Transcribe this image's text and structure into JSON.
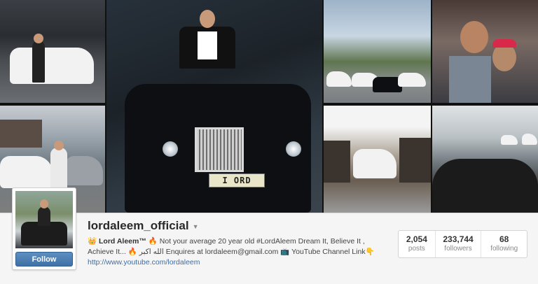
{
  "profile": {
    "username": "lordaleem_official",
    "bio_name": "👑 Lord Aleem™",
    "bio_line1": " 🔥 Not your average 20 year old #LordAleem Dream It, Believe It ,",
    "bio_line2": "Achieve It... 🔥 الله اكبر Enquires at lordaleem@gmail.com 📺 YouTube Channel Link👇",
    "website": "http://www.youtube.com/lordaleem",
    "follow_label": "Follow",
    "caret_icon": "caret-down-icon"
  },
  "stats": {
    "posts_count": "2,054",
    "posts_label": "posts",
    "followers_count": "233,744",
    "followers_label": "followers",
    "following_count": "68",
    "following_label": "following"
  },
  "mosaic": {
    "plate_text": "I ORD"
  },
  "colors": {
    "follow_button": "#3f71a6",
    "link": "#3f6da3"
  }
}
